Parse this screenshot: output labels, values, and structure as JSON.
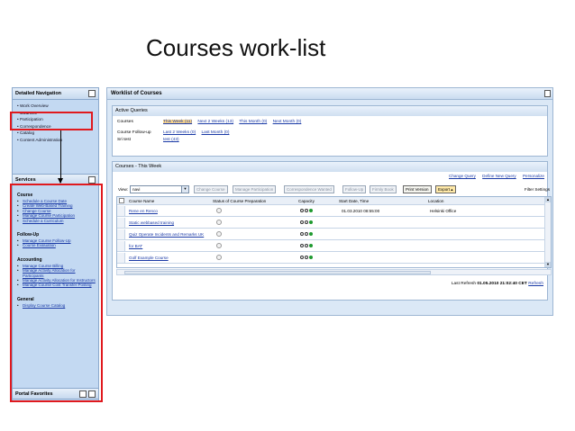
{
  "slide_title": "Courses work-list",
  "nav": {
    "title": "Detailed Navigation",
    "items": [
      {
        "label": "Work Overview",
        "selected": false
      },
      {
        "label": "Courses",
        "selected": true
      },
      {
        "label": "Participation",
        "selected": false
      },
      {
        "label": "Correspondence",
        "selected": false
      },
      {
        "label": "Catalog",
        "selected": false
      },
      {
        "label": "Content Administration",
        "selected": false
      }
    ]
  },
  "services": {
    "title": "Services",
    "groups": [
      {
        "title": "Course",
        "items": [
          "Schedule a Course Date",
          "Create Web-Based Training",
          "Change Course",
          "Manage Course Participation",
          "Schedule a Curriculum"
        ]
      },
      {
        "title": "Follow-Up",
        "items": [
          "Manage Course Follow-Up",
          "Course Evaluation"
        ]
      },
      {
        "title": "Accounting",
        "items": [
          "Manage Course Billing",
          "Manage Activity Allocation for Participants",
          "Manage Activity Allocation for Instructors",
          "Manage Course Cost Transfer Posting"
        ]
      },
      {
        "title": "General",
        "items": [
          "Display Course Catalog"
        ]
      }
    ]
  },
  "portal_favorites": "Portal Favorites",
  "worklist": {
    "title": "Worklist of Courses",
    "active_queries": {
      "title": "Active Queries",
      "rows": [
        {
          "label": "Courses",
          "links": [
            "This Week (11)",
            "Next 2 Weeks (13)",
            "This Month (0)",
            "Next Month (0)"
          ]
        },
        {
          "label": "Course Follow-up",
          "links": [
            "Last 2 Weeks (0)",
            "Last Month (0)"
          ]
        },
        {
          "label": "Sri test",
          "links": [
            "test (43)"
          ]
        }
      ]
    },
    "courses_table": {
      "title": "Courses - This Week",
      "top_links": [
        "Change Query",
        "Define New Query",
        "Personalize"
      ],
      "view_label": "View:",
      "view_value": "navi",
      "buttons": [
        {
          "label": "Change Course",
          "enabled": false
        },
        {
          "label": "Manage Participation",
          "enabled": false
        },
        {
          "label": "Correspondence Wanted",
          "enabled": false
        },
        {
          "label": "Follow-Up",
          "enabled": false
        },
        {
          "label": "Firmly Book",
          "enabled": false
        },
        {
          "label": "Print Version",
          "enabled": true
        },
        {
          "label": "Export",
          "enabled": true
        }
      ],
      "filter_settings": "Filter  Settings",
      "columns": [
        "Course Name",
        "Status of Course Preparation",
        "Capacity",
        "Start Date, Time",
        "Location"
      ],
      "rows": [
        {
          "name": "Rene en Renco",
          "start": "01.03.2010 08:55:00",
          "location": "Helsinki Office"
        },
        {
          "name": "Static webbased training",
          "start": "",
          "location": ""
        },
        {
          "name": "Quiz Operate Incidents and Remarks UK",
          "start": "",
          "location": ""
        },
        {
          "name": "for BAT",
          "start": "",
          "location": ""
        },
        {
          "name": "Golf Example Course",
          "start": "",
          "location": ""
        }
      ],
      "last_refresh_label": "Last Refresh",
      "last_refresh_value": "01.05.2010 21:02:40 CET",
      "refresh_link": "Refresh"
    }
  },
  "colors": {
    "highlight_red": "#e0191e",
    "capacity_green": "#1f9a2f",
    "link_blue": "#1a3aa6",
    "panel_blue": "#c3d9f2"
  }
}
